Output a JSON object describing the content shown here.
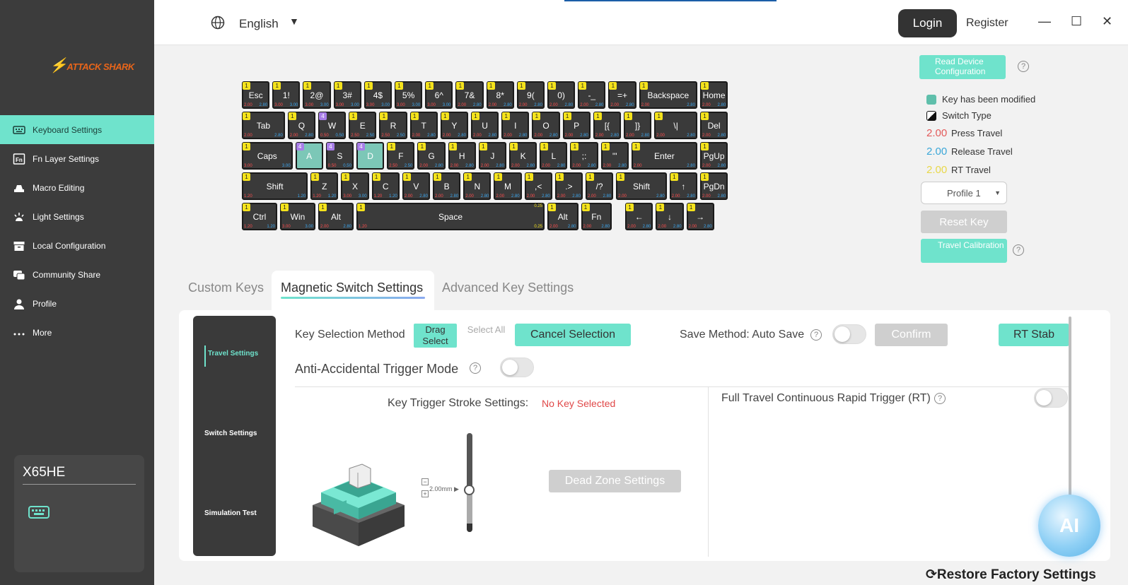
{
  "sidebar": {
    "logo_text": "ATTACK SHARK",
    "items": [
      {
        "label": "Keyboard Settings",
        "icon": "keyboard-icon"
      },
      {
        "label": "Fn Layer Settings",
        "icon": "fn-icon"
      },
      {
        "label": "Macro Editing",
        "icon": "macro-icon"
      },
      {
        "label": "Light Settings",
        "icon": "light-icon"
      },
      {
        "label": "Local Configuration",
        "icon": "archive-icon"
      },
      {
        "label": "Community Share",
        "icon": "share-icon"
      },
      {
        "label": "Profile",
        "icon": "user-icon"
      },
      {
        "label": "More",
        "icon": "more-icon"
      }
    ],
    "device_name": "X65HE"
  },
  "topbar": {
    "language": "English",
    "login": "Login",
    "register": "Register",
    "minimize": "—",
    "maximize": "☐",
    "close": "✕"
  },
  "keyboard": {
    "rows": [
      [
        {
          "l": "Esc",
          "b": "1",
          "p": "2.00",
          "r": "2.80"
        },
        {
          "l": "1!",
          "b": "1",
          "p": "3.00",
          "r": "3.00"
        },
        {
          "l": "2@",
          "b": "1",
          "p": "3.00",
          "r": "3.00"
        },
        {
          "l": "3#",
          "b": "1",
          "p": "3.00",
          "r": "3.00"
        },
        {
          "l": "4$",
          "b": "1",
          "p": "3.00",
          "r": "3.00"
        },
        {
          "l": "5%",
          "b": "1",
          "p": "3.00",
          "r": "3.00"
        },
        {
          "l": "6^",
          "b": "1",
          "p": "3.00",
          "r": "3.00"
        },
        {
          "l": "7&",
          "b": "1",
          "p": "2.00",
          "r": "2.80"
        },
        {
          "l": "8*",
          "b": "1",
          "p": "2.00",
          "r": "2.80"
        },
        {
          "l": "9(",
          "b": "1",
          "p": "2.00",
          "r": "2.80"
        },
        {
          "l": "0)",
          "b": "1",
          "p": "2.00",
          "r": "2.80"
        },
        {
          "l": "-_",
          "b": "1",
          "p": "2.00",
          "r": "2.80"
        },
        {
          "l": "=+",
          "b": "1",
          "p": "2.00",
          "r": "2.80"
        },
        {
          "l": "Backspace",
          "b": "1",
          "p": "2.00",
          "r": "2.80",
          "w": 2
        },
        {
          "l": "Home",
          "b": "1",
          "p": "2.00",
          "r": "2.80"
        }
      ],
      [
        {
          "l": "Tab",
          "b": "1",
          "p": "2.00",
          "r": "2.80",
          "w": 1.5
        },
        {
          "l": "Q",
          "b": "1",
          "p": "2.00",
          "r": "2.80"
        },
        {
          "l": "W",
          "b": "4",
          "p": "0.50",
          "r": "0.50",
          "pb": true
        },
        {
          "l": "E",
          "b": "1",
          "p": "2.50",
          "r": "2.50"
        },
        {
          "l": "R",
          "b": "1",
          "p": "2.50",
          "r": "2.50"
        },
        {
          "l": "T",
          "b": "1",
          "p": "2.00",
          "r": "2.80"
        },
        {
          "l": "Y",
          "b": "1",
          "p": "2.00",
          "r": "2.80"
        },
        {
          "l": "U",
          "b": "1",
          "p": "2.00",
          "r": "2.80"
        },
        {
          "l": "I",
          "b": "1",
          "p": "2.00",
          "r": "2.80"
        },
        {
          "l": "O",
          "b": "1",
          "p": "2.00",
          "r": "2.80"
        },
        {
          "l": "P",
          "b": "1",
          "p": "2.00",
          "r": "2.80"
        },
        {
          "l": "[{",
          "b": "1",
          "p": "2.00",
          "r": "2.80"
        },
        {
          "l": "]}",
          "b": "1",
          "p": "2.00",
          "r": "2.80"
        },
        {
          "l": "\\|",
          "b": "1",
          "p": "2.00",
          "r": "2.80",
          "w": 1.5
        },
        {
          "l": "Del",
          "b": "1",
          "p": "2.00",
          "r": "2.80"
        }
      ],
      [
        {
          "l": "Caps",
          "b": "1",
          "p": "3.00",
          "r": "3.00",
          "w": 1.75
        },
        {
          "l": "A",
          "b": "4",
          "p": "",
          "r": "",
          "pb": true,
          "teal": true
        },
        {
          "l": "S",
          "b": "4",
          "p": "0.50",
          "r": "0.50",
          "pb": true
        },
        {
          "l": "D",
          "b": "4",
          "p": "",
          "r": "",
          "pb": true,
          "teal": true
        },
        {
          "l": "F",
          "b": "1",
          "p": "2.50",
          "r": "2.50"
        },
        {
          "l": "G",
          "b": "1",
          "p": "2.00",
          "r": "2.80"
        },
        {
          "l": "H",
          "b": "1",
          "p": "2.00",
          "r": "2.80"
        },
        {
          "l": "J",
          "b": "1",
          "p": "2.00",
          "r": "2.80"
        },
        {
          "l": "K",
          "b": "1",
          "p": "2.00",
          "r": "2.80"
        },
        {
          "l": "L",
          "b": "1",
          "p": "2.00",
          "r": "2.80"
        },
        {
          "l": ";:",
          "b": "1",
          "p": "2.00",
          "r": "2.80"
        },
        {
          "l": "'\"",
          "b": "1",
          "p": "2.00",
          "r": "2.80"
        },
        {
          "l": "Enter",
          "b": "1",
          "p": "2.00",
          "r": "2.80",
          "w": 2.25
        },
        {
          "l": "PgUp",
          "b": "1",
          "p": "2.00",
          "r": "2.80"
        }
      ],
      [
        {
          "l": "Shift",
          "b": "1",
          "p": "1.20",
          "r": "1.20",
          "w": 2.25
        },
        {
          "l": "Z",
          "b": "1",
          "p": "1.20",
          "r": "1.20"
        },
        {
          "l": "X",
          "b": "1",
          "p": "3.00",
          "r": "3.00"
        },
        {
          "l": "C",
          "b": "1",
          "p": "1.20",
          "r": "1.20"
        },
        {
          "l": "V",
          "b": "1",
          "p": "2.00",
          "r": "2.80"
        },
        {
          "l": "B",
          "b": "1",
          "p": "2.00",
          "r": "2.80"
        },
        {
          "l": "N",
          "b": "1",
          "p": "2.00",
          "r": "2.80"
        },
        {
          "l": "M",
          "b": "1",
          "p": "2.00",
          "r": "2.80"
        },
        {
          "l": ",<",
          "b": "1",
          "p": "2.00",
          "r": "2.80"
        },
        {
          "l": ".>",
          "b": "1",
          "p": "2.00",
          "r": "2.80"
        },
        {
          "l": "/?",
          "b": "1",
          "p": "2.00",
          "r": "2.80"
        },
        {
          "l": "Shift",
          "b": "1",
          "p": "2.00",
          "r": "2.80",
          "w": 1.75
        },
        {
          "l": "↑",
          "b": "1",
          "p": "2.00",
          "r": "2.80"
        },
        {
          "l": "PgDn",
          "b": "1",
          "p": "2.00",
          "r": "2.80"
        }
      ],
      [
        {
          "l": "Ctrl",
          "b": "1",
          "p": "1.20",
          "r": "1.20",
          "w": 1.25
        },
        {
          "l": "Win",
          "b": "1",
          "p": "3.00",
          "r": "3.00",
          "w": 1.25
        },
        {
          "l": "Alt",
          "b": "1",
          "p": "2.00",
          "r": "2.80",
          "w": 1.25
        },
        {
          "l": "Space",
          "b": "1",
          "p": "1.20",
          "r": "",
          "t": "0.25",
          "w": 6.25
        },
        {
          "l": "Alt",
          "b": "1",
          "p": "2.00",
          "r": "2.80",
          "w": 1.1
        },
        {
          "l": "Fn",
          "b": "1",
          "p": "2.00",
          "r": "2.80",
          "w": 1.1
        },
        {
          "l": "←",
          "b": "1",
          "p": "2.00",
          "r": "2.80",
          "gap": 0.35
        },
        {
          "l": "↓",
          "b": "1",
          "p": "2.00",
          "r": "2.80"
        },
        {
          "l": "→",
          "b": "1",
          "p": "2.00",
          "r": "2.80"
        }
      ]
    ],
    "space_bottom_rt": "0.25"
  },
  "right_panel": {
    "read_device": "Read Device Configuration",
    "legend": {
      "modified": "Key has been modified",
      "switch_type": "Switch Type",
      "press_val": "2.00",
      "press_label": "Press Travel",
      "release_val": "2.00",
      "release_label": "Release Travel",
      "rt_val": "2.00",
      "rt_label": "RT Travel"
    },
    "profile": "Profile 1",
    "reset_key": "Reset Key",
    "travel_calibration": "Travel Calibration"
  },
  "tabs": [
    "Custom Keys",
    "Magnetic Switch Settings",
    "Advanced Key Settings"
  ],
  "subnav": [
    "Travel Settings",
    "Switch Settings",
    "Simulation Test"
  ],
  "panel": {
    "key_selection_method": "Key Selection Method",
    "drag_select": "Drag Select",
    "select_all": "Select All",
    "cancel_selection": "Cancel Selection",
    "save_method": "Save Method: Auto Save",
    "confirm": "Confirm",
    "rt_stab": "RT Stab",
    "anti_accidental": "Anti-Accidental Trigger Mode",
    "key_trigger_stroke": "Key Trigger Stroke Settings:",
    "no_key_selected": "No Key Selected",
    "slider_value": "2.00mm ▶",
    "dead_zone": "Dead Zone Settings",
    "full_travel_rt": "Full Travel Continuous Rapid Trigger (RT)"
  },
  "ai_label": "AI",
  "restore_factory": "Restore Factory Settings",
  "colors": {
    "accent": "#6fe3cc",
    "sidebar": "#3c3c3c",
    "press": "#ff4d4d",
    "release": "#3ba7f0",
    "rt": "#f5e31c"
  }
}
